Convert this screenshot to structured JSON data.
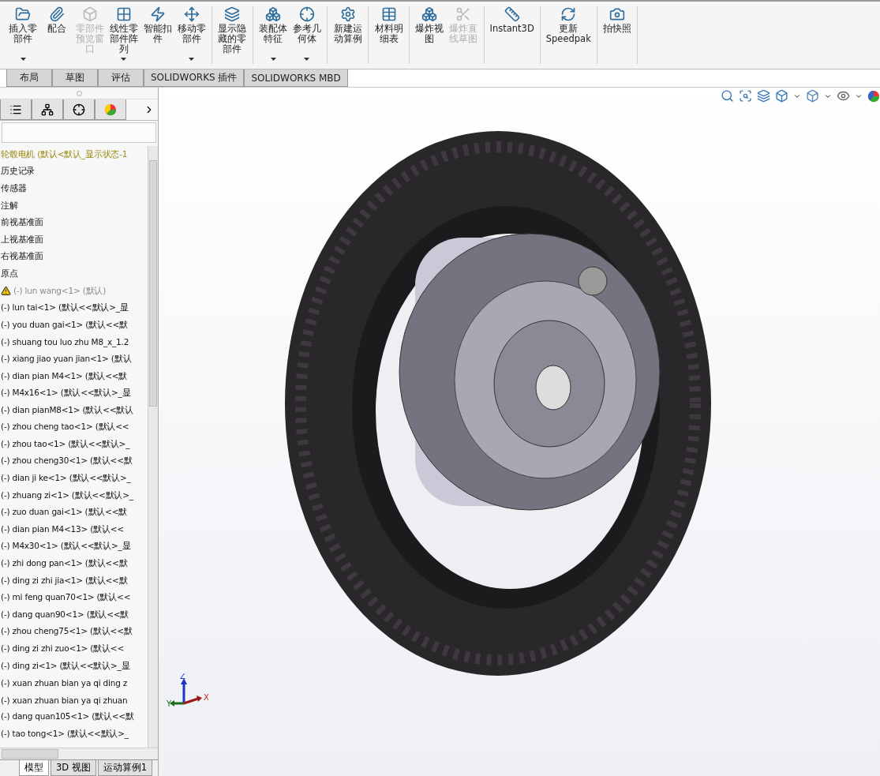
{
  "toolbar": {
    "groups": [
      {
        "buttons": [
          {
            "label": "插入零部件",
            "dropdown": true,
            "disabled": false
          },
          {
            "label": "配合",
            "dropdown": false,
            "disabled": false
          },
          {
            "label": "零部件预览窗口",
            "dropdown": false,
            "disabled": true
          },
          {
            "label": "线性零部件阵列",
            "dropdown": true,
            "disabled": false
          },
          {
            "label": "智能扣件",
            "dropdown": false,
            "disabled": false
          },
          {
            "label": "移动零部件",
            "dropdown": true,
            "disabled": false
          }
        ]
      },
      {
        "buttons": [
          {
            "label": "显示隐藏的零部件",
            "dropdown": false,
            "disabled": false
          }
        ]
      },
      {
        "buttons": [
          {
            "label": "装配体特征",
            "dropdown": true,
            "disabled": false
          },
          {
            "label": "参考几何体",
            "dropdown": true,
            "disabled": false
          }
        ]
      },
      {
        "buttons": [
          {
            "label": "新建运动算例",
            "dropdown": false,
            "disabled": false
          }
        ]
      },
      {
        "buttons": [
          {
            "label": "材料明细表",
            "dropdown": false,
            "disabled": false
          }
        ]
      },
      {
        "buttons": [
          {
            "label": "爆炸视图",
            "dropdown": false,
            "disabled": false
          },
          {
            "label": "爆炸直线草图",
            "dropdown": false,
            "disabled": true
          }
        ]
      },
      {
        "buttons": [
          {
            "label": "Instant3D",
            "dropdown": false,
            "disabled": false
          }
        ]
      },
      {
        "buttons": [
          {
            "label": "更新Speedpak",
            "dropdown": false,
            "disabled": false
          }
        ]
      },
      {
        "buttons": [
          {
            "label": "拍快照",
            "dropdown": false,
            "disabled": false
          }
        ]
      }
    ]
  },
  "command_tabs": [
    {
      "label": "布局",
      "selected": false
    },
    {
      "label": "草图",
      "selected": false
    },
    {
      "label": "评估",
      "selected": false
    },
    {
      "label": "SOLIDWORKS 插件",
      "selected": false
    },
    {
      "label": "SOLIDWORKS MBD",
      "selected": false
    }
  ],
  "feature_tree": {
    "items": [
      {
        "kind": "root",
        "text": "轮毂电机  (默认<默认_显示状态-1"
      },
      {
        "kind": "folder",
        "text": "历史记录"
      },
      {
        "kind": "folder",
        "text": "传感器"
      },
      {
        "kind": "folder",
        "text": "注解"
      },
      {
        "kind": "folder",
        "text": "前视基准面"
      },
      {
        "kind": "folder",
        "text": "上视基准面"
      },
      {
        "kind": "folder",
        "text": "右视基准面"
      },
      {
        "kind": "folder",
        "text": "原点"
      },
      {
        "kind": "warning",
        "text": "(-) lun wang<1> (默认)"
      },
      {
        "kind": "part",
        "text": "(-) lun tai<1> (默认<<默认>_显"
      },
      {
        "kind": "part",
        "text": "(-) you duan gai<1> (默认<<默"
      },
      {
        "kind": "part",
        "text": "(-) shuang tou luo zhu M8_x_1.2"
      },
      {
        "kind": "part",
        "text": "(-) xiang jiao yuan jian<1> (默认"
      },
      {
        "kind": "part",
        "text": "(-) dian pian M4<1> (默认<<默"
      },
      {
        "kind": "part",
        "text": "(-) M4x16<1> (默认<<默认>_显"
      },
      {
        "kind": "part",
        "text": "(-) dian pianM8<1> (默认<<默认"
      },
      {
        "kind": "part",
        "text": "(-) zhou cheng tao<1> (默认<<"
      },
      {
        "kind": "part",
        "text": "(-) zhou tao<1> (默认<<默认>_"
      },
      {
        "kind": "part",
        "text": "(-) zhou cheng30<1> (默认<<默"
      },
      {
        "kind": "part",
        "text": "(-) dian ji ke<1> (默认<<默认>_"
      },
      {
        "kind": "part",
        "text": "(-) zhuang zi<1> (默认<<默认>_"
      },
      {
        "kind": "part",
        "text": "(-) zuo duan gai<1> (默认<<默"
      },
      {
        "kind": "part",
        "text": "(-) dian pian M4<13> (默认<<"
      },
      {
        "kind": "part",
        "text": "(-) M4x30<1> (默认<<默认>_显"
      },
      {
        "kind": "part",
        "text": "(-) zhi dong pan<1> (默认<<默"
      },
      {
        "kind": "part",
        "text": "(-) ding zi zhi jia<1> (默认<<默"
      },
      {
        "kind": "part",
        "text": "(-) mi feng quan70<1> (默认<<"
      },
      {
        "kind": "part",
        "text": "(-) dang quan90<1> (默认<<默"
      },
      {
        "kind": "part",
        "text": "(-) zhou cheng75<1> (默认<<默"
      },
      {
        "kind": "part",
        "text": "(-) ding zi zhi zuo<1> (默认<<"
      },
      {
        "kind": "part",
        "text": "(-) ding zi<1> (默认<<默认>_显"
      },
      {
        "kind": "part",
        "text": "(-) xuan zhuan bian ya qi ding z"
      },
      {
        "kind": "part",
        "text": "(-) xuan zhuan bian ya qi zhuan"
      },
      {
        "kind": "part",
        "text": "(-) dang quan105<1> (默认<<默"
      },
      {
        "kind": "part",
        "text": "(-) tao tong<1> (默认<<默认>_"
      }
    ]
  },
  "triad": {
    "x": "X",
    "y": "Y",
    "z": "Z"
  },
  "bottom_tabs": [
    {
      "label": "模型",
      "selected": true
    },
    {
      "label": "3D 视图",
      "selected": false
    },
    {
      "label": "运动算例1",
      "selected": false
    }
  ]
}
